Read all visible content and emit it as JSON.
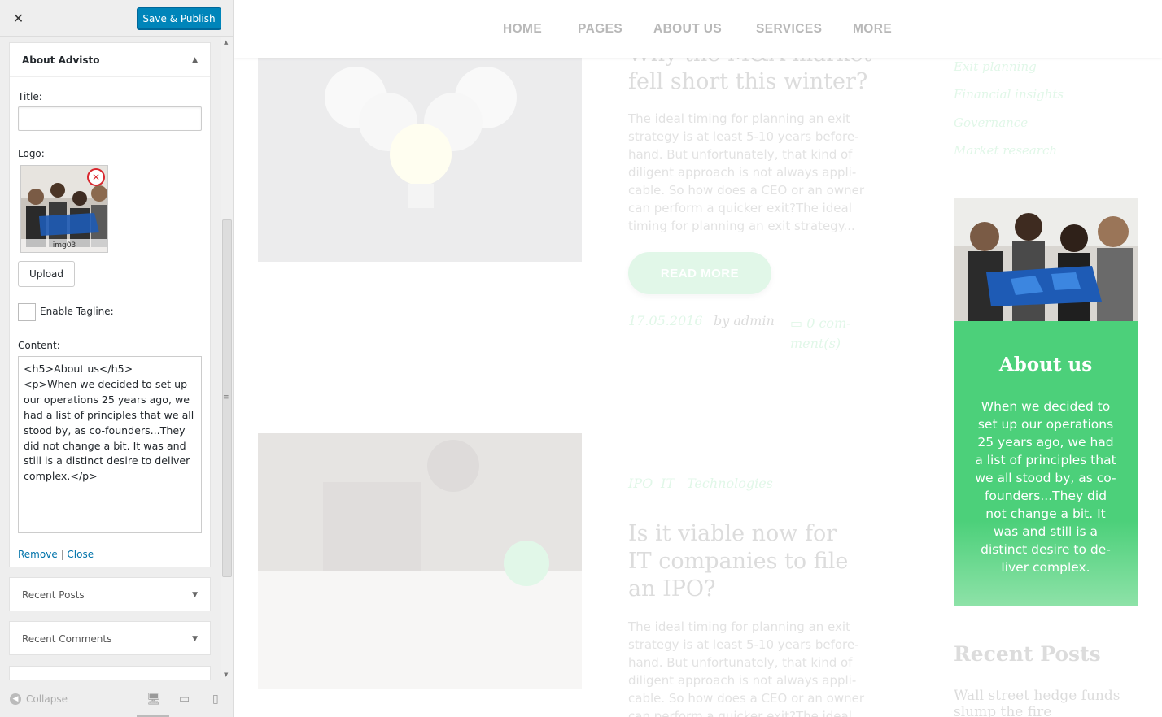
{
  "customizer": {
    "close_label": "✕",
    "publish_label": "Save & Publish",
    "widget": {
      "title": "About Advisto",
      "title_label": "Title:",
      "title_value": "",
      "logo_label": "Logo:",
      "logo_caption": "img03",
      "upload_label": "Upload",
      "tagline_label": "Enable Tagline:",
      "content_label": "Content:",
      "content_value": "<h5>About us</h5>\n<p>When we decided to set up our operations 25 years ago, we had a list of principles that we all stood by, as co-founders...They did not change a bit. It was and still is a distinct desire to deliver complex.</p>",
      "remove_link": "Remove",
      "separator": "|",
      "close_link": "Close"
    },
    "other_widgets": [
      "Recent Posts",
      "Recent Comments"
    ],
    "collapse_label": "Collapse"
  },
  "preview": {
    "nav": [
      "HOME",
      "PAGES",
      "ABOUT US",
      "SERVICES",
      "MORE"
    ],
    "post1": {
      "title_line1": "Why the M&A market",
      "title_line2": "fell short this winter?",
      "excerpt": "The ideal timing for planning an exit strategy is at least 5-10 years before-hand. But unfortunately, that kind of diligent approach is not always appli-cable. So how does a CEO or an owner can perform a quicker exit?The ideal timing for planning an exit strategy...",
      "read_more": "READ MORE",
      "date": "17.05.2016",
      "author": "by admin",
      "comments": "0 com-ment(s)"
    },
    "post2": {
      "tags": [
        "IPO",
        "IT",
        "Technologies"
      ],
      "title": "Is it viable now for IT companies to file an IPO?",
      "excerpt": "The ideal timing for planning an exit strategy is at least 5-10 years before-hand. But unfortunately, that kind of diligent approach is not always appli-cable. So how does a CEO or an owner can perform a quicker exit?The ideal"
    },
    "categories": [
      "Exit planning",
      "Financial insights",
      "Governance",
      "Market research"
    ],
    "about": {
      "heading": "About us",
      "text": "When we decided to set up our operations 25 years ago, we had a list of principles that we all stood by, as co-founders...They did not change a bit. It was and still is a distinct desire to de-liver complex."
    },
    "recent_posts_title": "Recent Posts",
    "recent_first": "Wall street hedge funds slump the fire"
  },
  "colors": {
    "accent": "#4cd07a",
    "publish": "#0085ba",
    "link": "#0073aa"
  }
}
